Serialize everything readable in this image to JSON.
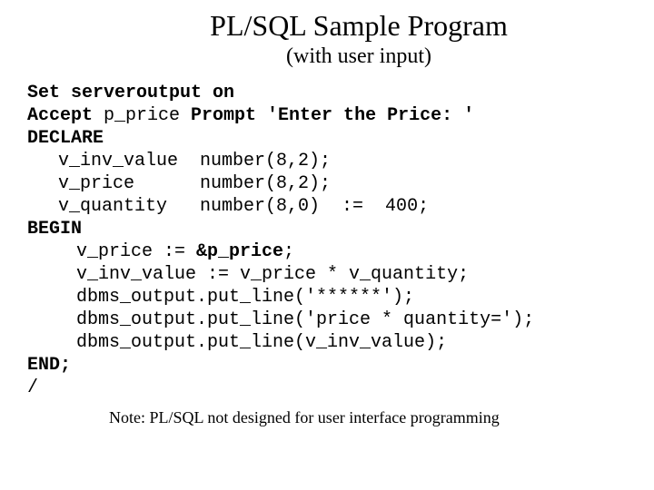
{
  "title": "PL/SQL Sample Program",
  "subtitle": "(with user input)",
  "code": {
    "l1a": "Set serveroutput on",
    "l2a": "Accept ",
    "l2b": "p_price",
    "l2c": " Prompt 'Enter the Price: '",
    "l3": "DECLARE",
    "l4": "v_inv_value  number(8,2);",
    "l5": "v_price      number(8,2);",
    "l6": "v_quantity   number(8,0)  :=  400;",
    "l7": "BEGIN",
    "l8a": "v_price := ",
    "l8b": "&p_price",
    "l8c": ";",
    "l9": "v_inv_value := v_price * v_quantity;",
    "l10": "dbms_output.put_line('******');",
    "l11": "dbms_output.put_line('price * quantity=');",
    "l12": "dbms_output.put_line(v_inv_value);",
    "l13": "END;",
    "l14": "/"
  },
  "footnote": "Note:  PL/SQL not designed for user interface programming"
}
